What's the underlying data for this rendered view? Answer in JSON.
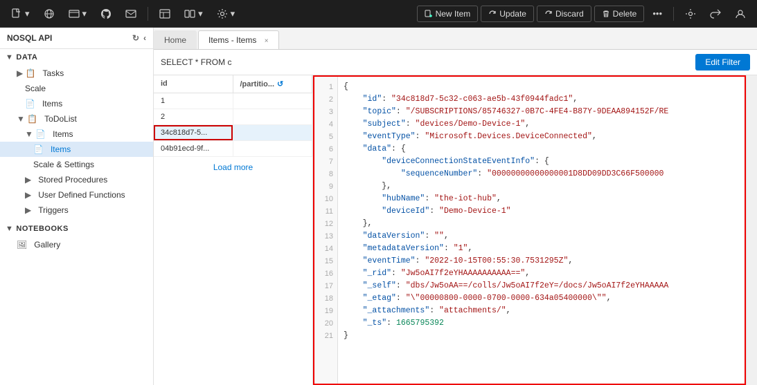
{
  "app": {
    "title": "NOSQL API"
  },
  "toolbar": {
    "new_item_label": "New Item",
    "update_label": "Update",
    "discard_label": "Discard",
    "delete_label": "Delete"
  },
  "tabs": {
    "home_label": "Home",
    "active_label": "Items - Items",
    "active_close": "×"
  },
  "query": {
    "text": "SELECT * FROM c",
    "filter_btn": "Edit Filter"
  },
  "sidebar": {
    "header": "NOSQL API",
    "sections": [
      {
        "name": "DATA",
        "items": [
          {
            "label": "Tasks",
            "level": 1,
            "icon": "📋",
            "type": "folder"
          },
          {
            "label": "Scale",
            "level": 2,
            "icon": ""
          },
          {
            "label": "Items",
            "level": 2,
            "icon": "📄"
          },
          {
            "label": "ToDoList",
            "level": 1,
            "icon": "📋",
            "type": "folder"
          },
          {
            "label": "Items",
            "level": 2,
            "icon": "📄",
            "type": "folder"
          },
          {
            "label": "Items",
            "level": 3,
            "icon": "📄",
            "active": true
          },
          {
            "label": "Scale & Settings",
            "level": 3,
            "icon": ""
          },
          {
            "label": "Stored Procedures",
            "level": 2,
            "icon": ""
          },
          {
            "label": "User Defined Functions",
            "level": 2,
            "icon": ""
          },
          {
            "label": "Triggers",
            "level": 2,
            "icon": ""
          }
        ]
      },
      {
        "name": "NOTEBOOKS",
        "items": [
          {
            "label": "Gallery",
            "level": 1,
            "icon": "🖼"
          }
        ]
      }
    ]
  },
  "table": {
    "columns": [
      "id",
      "/partitio..."
    ],
    "rows": [
      {
        "id": "1",
        "partition": ""
      },
      {
        "id": "2",
        "partition": ""
      },
      {
        "id": "34c818d7-5...",
        "partition": "",
        "highlighted": true
      },
      {
        "id": "04b91ecd-9f...",
        "partition": ""
      }
    ],
    "load_more": "Load more"
  },
  "json": {
    "lines": [
      {
        "num": 1,
        "content": "{"
      },
      {
        "num": 2,
        "content": "    \"id\": \"34c818d7-5c32-c063-ae5b-43f0944fadc1\","
      },
      {
        "num": 3,
        "content": "    \"topic\": \"/SUBSCRIPTIONS/85746327-0B7C-4FE4-B87Y-9DEAA894152F/RE"
      },
      {
        "num": 4,
        "content": "    \"subject\": \"devices/Demo-Device-1\","
      },
      {
        "num": 5,
        "content": "    \"eventType\": \"Microsoft.Devices.DeviceConnected\","
      },
      {
        "num": 6,
        "content": "    \"data\": {"
      },
      {
        "num": 7,
        "content": "        \"deviceConnectionStateEventInfo\": {"
      },
      {
        "num": 8,
        "content": "            \"sequenceNumber\": \"00000000000000001D8DD09DD3C66F500000"
      },
      {
        "num": 9,
        "content": "        },"
      },
      {
        "num": 10,
        "content": "        \"hubName\": \"the-iot-hub\","
      },
      {
        "num": 11,
        "content": "        \"deviceId\": \"Demo-Device-1\""
      },
      {
        "num": 12,
        "content": "    },"
      },
      {
        "num": 13,
        "content": "    \"dataVersion\": \"\","
      },
      {
        "num": 14,
        "content": "    \"metadataVersion\": \"1\","
      },
      {
        "num": 15,
        "content": "    \"eventTime\": \"2022-10-15T00:55:30.7531295Z\","
      },
      {
        "num": 16,
        "content": "    \"_rid\": \"Jw5oAI7f2eYHAAAAAAAAAA==\","
      },
      {
        "num": 17,
        "content": "    \"_self\": \"dbs/Jw5oAA==/colls/Jw5oAI7f2eY=/docs/Jw5oAI7f2eYHAAAAA"
      },
      {
        "num": 18,
        "content": "    \"_etag\": \"\\\"00000800-0000-0700-0000-634a05400000\\\"\","
      },
      {
        "num": 19,
        "content": "    \"_attachments\": \"attachments/\","
      },
      {
        "num": 20,
        "content": "    \"_ts\": 1665795392"
      },
      {
        "num": 21,
        "content": "}"
      }
    ]
  },
  "colors": {
    "accent": "#0078d4",
    "active_highlight": "#dbe9f8",
    "json_border": "#cc0000",
    "toolbar_bg": "#1e1e1e"
  }
}
